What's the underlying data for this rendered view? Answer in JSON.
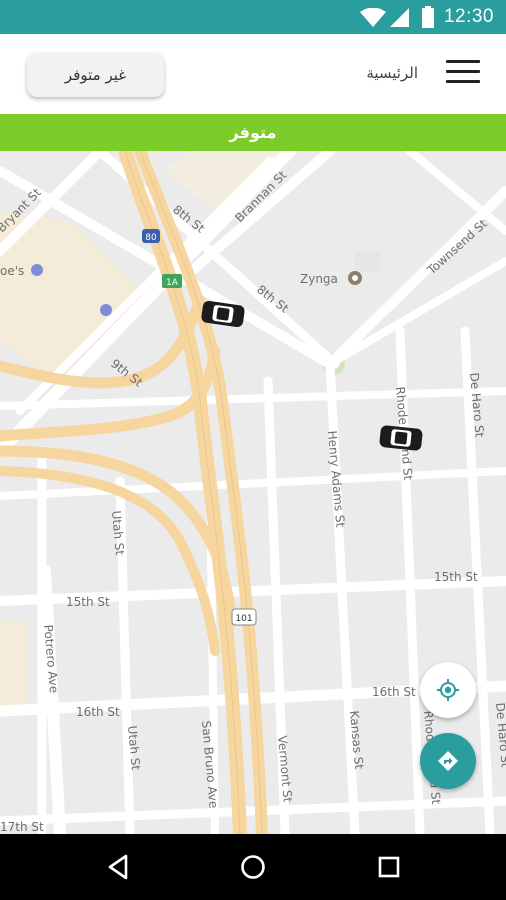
{
  "status_bar": {
    "time": "12:30",
    "icons": [
      "wifi-icon",
      "signal-icon",
      "battery-icon"
    ]
  },
  "header": {
    "title": "الرئيسية",
    "offline_button": "غير متوفر",
    "menu_icon": "hamburger-menu-icon"
  },
  "availability": {
    "label": "متوفر",
    "color": "#7ccc2a"
  },
  "theme": {
    "primary": "#2a9d9f"
  },
  "map": {
    "street_labels": {
      "bryant": "Bryant St",
      "eighth_a": "8th St",
      "brannan": "Brannan St",
      "eighth_b": "8th St",
      "townsend": "Townsend St",
      "ninth": "9th St",
      "rhode": "Rhode Island St",
      "de_haro": "De Haro St",
      "henry": "Henry Adams St",
      "utah_a": "Utah St",
      "fifteenth_a": "15th St",
      "fifteenth_b": "15th St",
      "potrero": "Potrero Ave",
      "sixteenth_a": "16th St",
      "sixteenth_b": "16th St",
      "utah_b": "Utah St",
      "san_bruno": "San Bruno Ave",
      "vermont": "Vermont St",
      "kansas": "Kansas St",
      "rhode_b": "Rhode Island St",
      "de_haro_b": "De Haro St",
      "seventeenth": "17th St",
      "poi_partial": "oe's"
    },
    "poi": "Zynga",
    "highway_shields": [
      "80",
      "1A",
      "101"
    ],
    "vehicles": [
      "car-icon",
      "car-icon"
    ]
  },
  "buttons": {
    "locate": "my-location-icon",
    "navigate": "directions-icon"
  },
  "nav_bar": [
    "back-icon",
    "home-icon",
    "recents-icon"
  ]
}
